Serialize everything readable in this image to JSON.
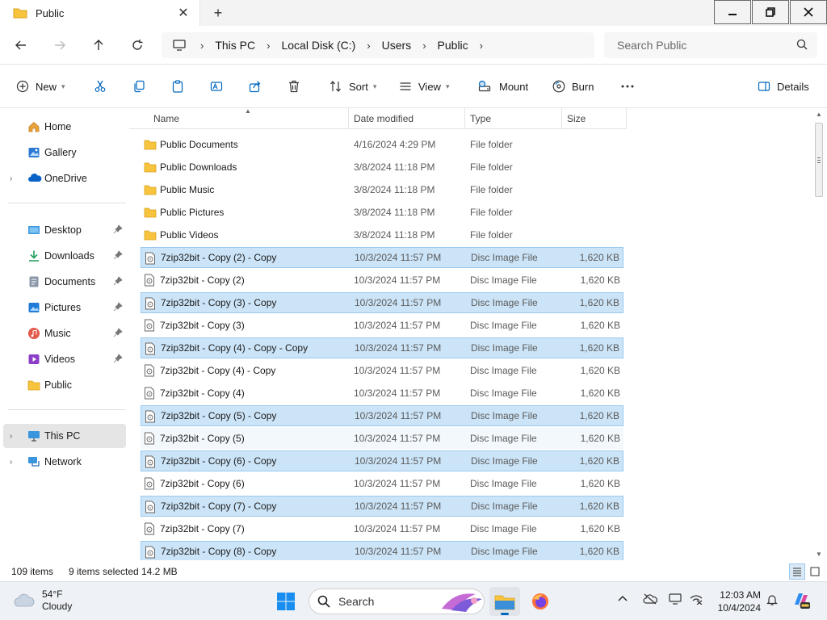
{
  "window": {
    "tab_title": "Public",
    "tab_close_glyph": "✕",
    "new_tab_glyph": "+"
  },
  "address": {
    "crumbs": [
      "This PC",
      "Local Disk (C:)",
      "Users",
      "Public"
    ],
    "search_placeholder": "Search Public"
  },
  "toolbar": {
    "new_label": "New",
    "sort_label": "Sort",
    "view_label": "View",
    "mount_label": "Mount",
    "burn_label": "Burn",
    "details_label": "Details"
  },
  "sidebar": {
    "items": [
      {
        "label": "Home",
        "icon": "home-icon"
      },
      {
        "label": "Gallery",
        "icon": "gallery-icon"
      },
      {
        "label": "OneDrive",
        "icon": "onedrive-icon"
      },
      {
        "label": "Desktop",
        "icon": "desktop-icon"
      },
      {
        "label": "Downloads",
        "icon": "downloads-icon"
      },
      {
        "label": "Documents",
        "icon": "documents-icon"
      },
      {
        "label": "Pictures",
        "icon": "pictures-icon"
      },
      {
        "label": "Music",
        "icon": "music-icon"
      },
      {
        "label": "Videos",
        "icon": "videos-icon"
      },
      {
        "label": "Public",
        "icon": "folder-icon"
      },
      {
        "label": "This PC",
        "icon": "this-pc-icon"
      },
      {
        "label": "Network",
        "icon": "network-icon"
      }
    ]
  },
  "columns": {
    "name": "Name",
    "date": "Date modified",
    "type": "Type",
    "size": "Size"
  },
  "files": [
    {
      "name": "Public Documents",
      "date": "4/16/2024 4:29 PM",
      "type": "File folder",
      "size": "",
      "kind": "folder",
      "selected": false
    },
    {
      "name": "Public Downloads",
      "date": "3/8/2024 11:18 PM",
      "type": "File folder",
      "size": "",
      "kind": "folder",
      "selected": false
    },
    {
      "name": "Public Music",
      "date": "3/8/2024 11:18 PM",
      "type": "File folder",
      "size": "",
      "kind": "folder",
      "selected": false
    },
    {
      "name": "Public Pictures",
      "date": "3/8/2024 11:18 PM",
      "type": "File folder",
      "size": "",
      "kind": "folder",
      "selected": false
    },
    {
      "name": "Public Videos",
      "date": "3/8/2024 11:18 PM",
      "type": "File folder",
      "size": "",
      "kind": "folder",
      "selected": false
    },
    {
      "name": "7zip32bit - Copy (2) - Copy",
      "date": "10/3/2024 11:57 PM",
      "type": "Disc Image File",
      "size": "1,620 KB",
      "kind": "file",
      "selected": true
    },
    {
      "name": "7zip32bit - Copy (2)",
      "date": "10/3/2024 11:57 PM",
      "type": "Disc Image File",
      "size": "1,620 KB",
      "kind": "file",
      "selected": false
    },
    {
      "name": "7zip32bit - Copy (3) - Copy",
      "date": "10/3/2024 11:57 PM",
      "type": "Disc Image File",
      "size": "1,620 KB",
      "kind": "file",
      "selected": true
    },
    {
      "name": "7zip32bit - Copy (3)",
      "date": "10/3/2024 11:57 PM",
      "type": "Disc Image File",
      "size": "1,620 KB",
      "kind": "file",
      "selected": false
    },
    {
      "name": "7zip32bit - Copy (4) - Copy - Copy",
      "date": "10/3/2024 11:57 PM",
      "type": "Disc Image File",
      "size": "1,620 KB",
      "kind": "file",
      "selected": true
    },
    {
      "name": "7zip32bit - Copy (4) - Copy",
      "date": "10/3/2024 11:57 PM",
      "type": "Disc Image File",
      "size": "1,620 KB",
      "kind": "file",
      "selected": false
    },
    {
      "name": "7zip32bit - Copy (4)",
      "date": "10/3/2024 11:57 PM",
      "type": "Disc Image File",
      "size": "1,620 KB",
      "kind": "file",
      "selected": false
    },
    {
      "name": "7zip32bit - Copy (5) - Copy",
      "date": "10/3/2024 11:57 PM",
      "type": "Disc Image File",
      "size": "1,620 KB",
      "kind": "file",
      "selected": true
    },
    {
      "name": "7zip32bit - Copy (5)",
      "date": "10/3/2024 11:57 PM",
      "type": "Disc Image File",
      "size": "1,620 KB",
      "kind": "file",
      "selected": false,
      "hover": true
    },
    {
      "name": "7zip32bit - Copy (6) - Copy",
      "date": "10/3/2024 11:57 PM",
      "type": "Disc Image File",
      "size": "1,620 KB",
      "kind": "file",
      "selected": true
    },
    {
      "name": "7zip32bit - Copy (6)",
      "date": "10/3/2024 11:57 PM",
      "type": "Disc Image File",
      "size": "1,620 KB",
      "kind": "file",
      "selected": false
    },
    {
      "name": "7zip32bit - Copy (7) - Copy",
      "date": "10/3/2024 11:57 PM",
      "type": "Disc Image File",
      "size": "1,620 KB",
      "kind": "file",
      "selected": true
    },
    {
      "name": "7zip32bit - Copy (7)",
      "date": "10/3/2024 11:57 PM",
      "type": "Disc Image File",
      "size": "1,620 KB",
      "kind": "file",
      "selected": false
    },
    {
      "name": "7zip32bit - Copy (8) - Copy",
      "date": "10/3/2024 11:57 PM",
      "type": "Disc Image File",
      "size": "1,620 KB",
      "kind": "file",
      "selected": true
    }
  ],
  "status": {
    "item_count": "109 items",
    "selection": "9 items selected",
    "selection_size": "14.2 MB"
  },
  "taskbar": {
    "weather_temp": "54°F",
    "weather_desc": "Cloudy",
    "search_label": "Search",
    "time": "12:03 AM",
    "date": "10/4/2024"
  },
  "colors": {
    "selection_bg": "#cce4f7",
    "selection_border": "#99c9ef",
    "folder_yellow": "#f8c33d",
    "accent_blue": "#0067c0"
  }
}
